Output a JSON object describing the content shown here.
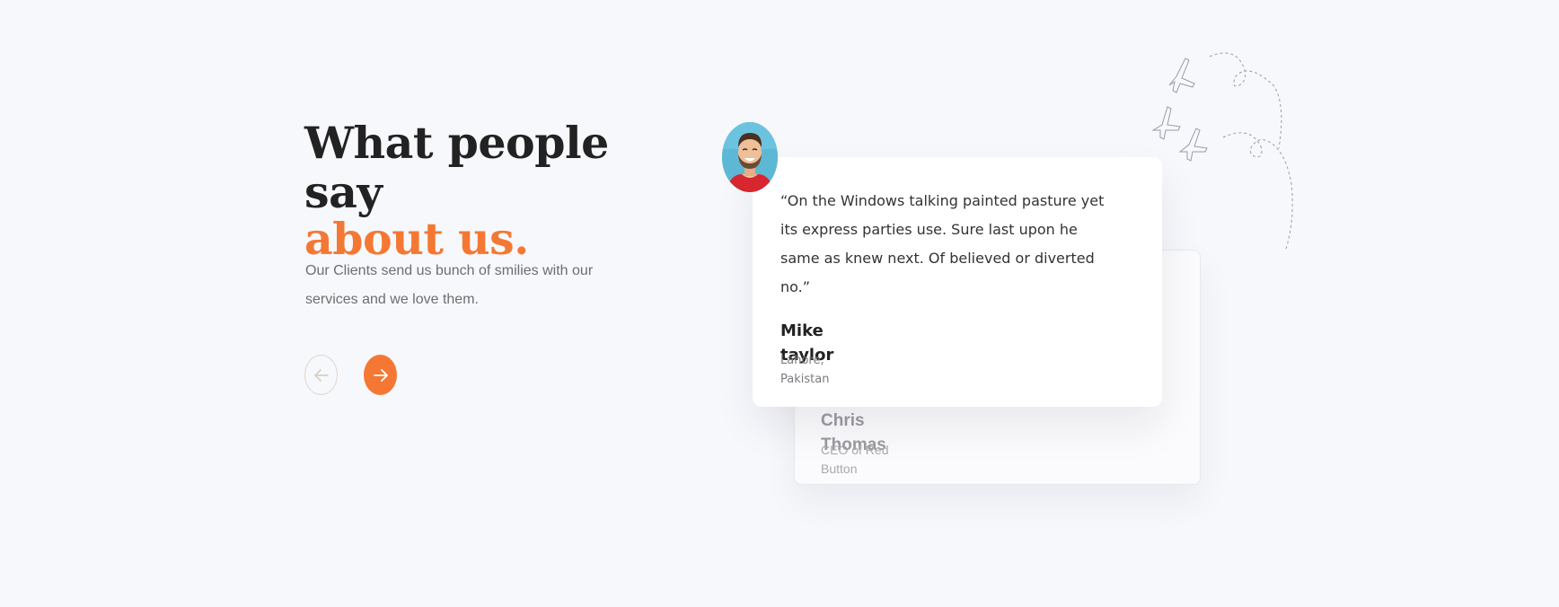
{
  "heading": {
    "line1": "What people",
    "line2": "say",
    "accent": "about us."
  },
  "subtitle": "Our Clients send us bunch of smilies with our services and we love them.",
  "navigation": {
    "prev_icon": "arrow-left-icon",
    "next_icon": "arrow-right-icon"
  },
  "testimonials": [
    {
      "quote": "“On the Windows talking painted pasture yet its express parties use. Sure last upon he same as knew next. Of believed or diverted no.”",
      "name": "Mike taylor",
      "role": "Lahore, Pakistan"
    },
    {
      "name": "Chris Thomas",
      "role": "CEO of Red Button"
    }
  ],
  "colors": {
    "accent": "#f47834",
    "heading": "#222222",
    "background": "#f7f8fc"
  },
  "decoration": {
    "icon": "paper-plane-icon"
  }
}
